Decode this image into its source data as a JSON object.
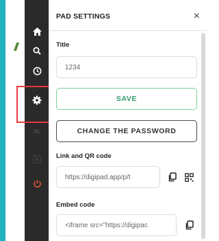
{
  "panel": {
    "title": "PAD SETTINGS",
    "close_glyph": "×",
    "title_label": "Title",
    "title_value": "1234",
    "save_label": "SAVE",
    "change_password_label": "CHANGE THE PASSWORD",
    "link_label": "Link and QR code",
    "link_value": "https://digipad.app/p/t",
    "embed_label": "Embed code",
    "embed_value": "<iframe src=\"https://digipac"
  },
  "sidebar": {
    "icons": [
      "home-icon",
      "search-icon",
      "clock-icon",
      "gear-icon",
      "hand-icon",
      "square-icon",
      "power-icon"
    ]
  },
  "colors": {
    "sidebar_bg": "#2a2a2a",
    "accent_green": "#2f9b6b",
    "highlight_red": "#e8383d",
    "power_red": "#e0553a"
  }
}
